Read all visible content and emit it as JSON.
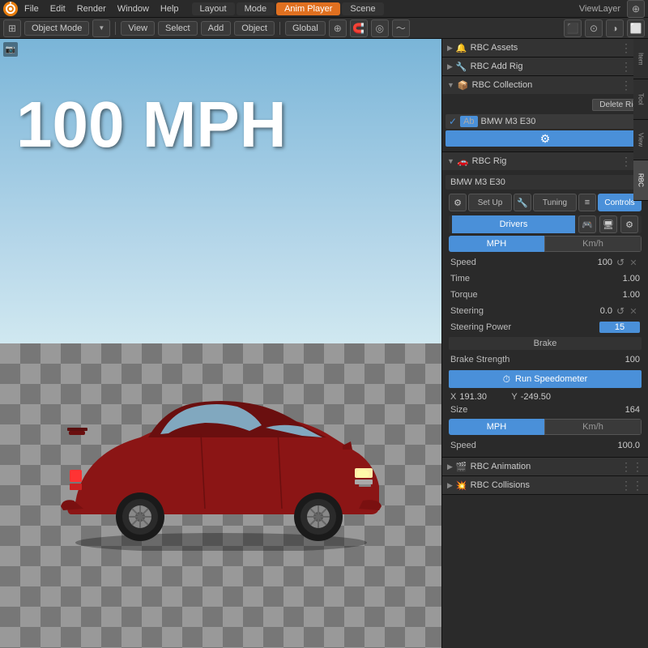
{
  "topbar": {
    "menus": [
      "File",
      "Edit",
      "Render",
      "Window",
      "Help"
    ],
    "workspace_tabs": [
      "Layout",
      "Mode",
      "Anim Player",
      "Scene"
    ],
    "viewlayer": "ViewLayer"
  },
  "toolbar": {
    "object_mode": "Object Mode",
    "view": "View",
    "select": "Select",
    "add": "Add",
    "object": "Object",
    "transform": "Global",
    "icons": [
      "⊕",
      "↔",
      "◎",
      "~"
    ]
  },
  "viewport": {
    "speed_text": "100 MPH"
  },
  "right_panel": {
    "side_tabs": [
      "Item",
      "Tool",
      "View",
      "RBC"
    ],
    "rbc_assets": {
      "label": "RBC Assets",
      "icon": "🔔"
    },
    "rbc_add_rig": {
      "label": "RBC Add Rig",
      "icon": "🔧"
    },
    "rbc_collection": {
      "label": "RBC Collection",
      "delete_rig": "Delete Rig",
      "car_name": "BMW M3 E30",
      "gear_icon": "⚙"
    },
    "rbc_rig": {
      "label": "RBC Rig",
      "car_name": "BMW M3 E30",
      "tabs": [
        "Set Up",
        "Tuning",
        "Controls"
      ],
      "controls_label": "Controls",
      "tuning_label": "Tuning",
      "setup_label": "Set Up",
      "drivers_label": "Drivers",
      "unit_mph": "MPH",
      "unit_kmh": "Km/h",
      "fields": [
        {
          "label": "Speed",
          "value": "100",
          "has_reset": true,
          "has_x": true
        },
        {
          "label": "Time",
          "value": "1.00",
          "has_reset": false,
          "has_x": false
        },
        {
          "label": "Torque",
          "value": "1.00",
          "has_reset": false,
          "has_x": false
        },
        {
          "label": "Steering",
          "value": "0.0",
          "has_reset": true,
          "has_x": true
        },
        {
          "label": "Steering Power",
          "value": "15",
          "is_blue": true,
          "has_reset": false,
          "has_x": false
        }
      ],
      "brake_label": "Brake",
      "brake_strength_label": "Brake Strength",
      "brake_strength_value": "100"
    },
    "speedometer": {
      "label": "Run Speedometer",
      "icon": "⏱",
      "x_label": "X",
      "x_value": "191.30",
      "y_label": "Y",
      "y_value": "-249.50",
      "size_label": "Size",
      "size_value": "164",
      "unit_mph": "MPH",
      "unit_kmh": "Km/h",
      "speed_label": "Speed",
      "speed_value": "100.0"
    },
    "rbc_animation": {
      "label": "RBC Animation",
      "icon": "🎬"
    },
    "rbc_collisions": {
      "label": "RBC Collisions",
      "icon": "💥"
    }
  }
}
